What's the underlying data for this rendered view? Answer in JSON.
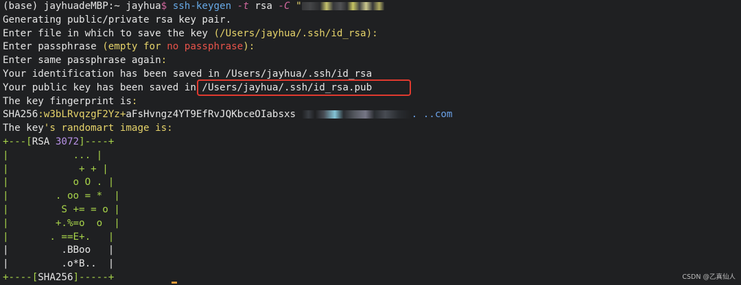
{
  "terminal": {
    "lines": [
      {
        "prompt": "(base) jayhuadeMBP:~ jayhua",
        "dollar": "$",
        "cmd": "ssh-keygen",
        "flag_t": "-t",
        "arg_rsa": "rsa",
        "flag_c": "-C",
        "arg_email": "\""
      },
      "Generating public/private rsa key pair.",
      {
        "a": "Enter file in which to save the key ",
        "b": "(/Users/jayhua/.ssh/id_rsa):"
      },
      {
        "a": "Enter passphrase ",
        "b": "(empty for ",
        "c": "no passphrase",
        "d": "):"
      },
      {
        "a": "Enter same passphrase again",
        "b": ":"
      },
      "Your identification has been saved in /Users/jayhua/.ssh/id_rsa",
      {
        "a": "Your public key has been saved in ",
        "b": "/Users/jayhua/.ssh/id_rsa.pub"
      },
      {
        "a": "The key fingerprint is",
        "b": ":"
      },
      {
        "a": "SHA256",
        "b": ":w3bLRvqzgF2Yz",
        "c": "+",
        "d": "aFsHvngz4YT9EfRvJQKbceOIabsxs ",
        "e": ". ..",
        "f": "com"
      },
      {
        "a": "The key",
        "b": "'s randomart image is:"
      }
    ],
    "randomart": {
      "top_a": "+---[",
      "top_b": "RSA",
      "top_c": " 3072",
      "top_d": "]----+",
      "rows": [
        "|           ... |",
        "|            + + |",
        "|           o O . |",
        "|        . oo = *  |",
        "|         S += = o |",
        "|        +.%=o  o  |",
        "|       . ==E+.   |",
        "|         .BBoo   |",
        "|         .o*B..  |"
      ],
      "bottom_a": "+----[",
      "bottom_b": "SHA256",
      "bottom_c": "]-----+"
    }
  },
  "watermark": "CSDN @乙真仙人",
  "colors": {
    "background": "#1f2022",
    "highlight_border": "#e03a2f"
  }
}
